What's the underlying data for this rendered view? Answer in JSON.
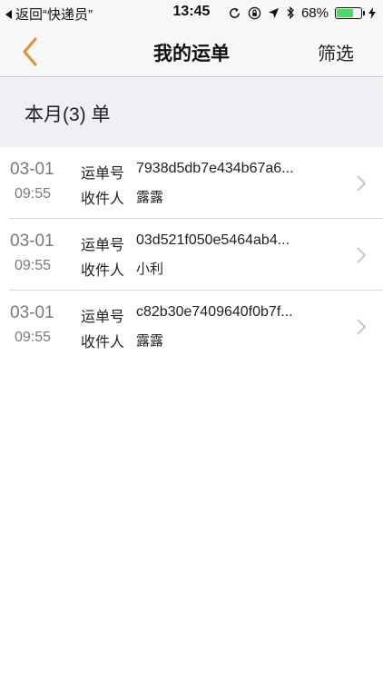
{
  "status_bar": {
    "back_label": "返回“快递员”",
    "time": "13:45",
    "battery_percent": "68%",
    "battery_level": 0.68,
    "icons": [
      "rotation-lock-icon",
      "lock-icon",
      "location-arrow-icon",
      "bluetooth-icon",
      "battery-icon",
      "charging-bolt-icon"
    ]
  },
  "nav": {
    "back_icon": "chevron-left-icon",
    "title": "我的运单",
    "filter_label": "筛选",
    "accent_color": "#e8902a"
  },
  "section": {
    "header": "本月(3) 单"
  },
  "orders": [
    {
      "date": "03-01",
      "time": "09:55",
      "waybill_label": "运单号",
      "waybill_no": "7938d5db7e434b67a6...",
      "recipient_label": "收件人",
      "recipient": "露露"
    },
    {
      "date": "03-01",
      "time": "09:55",
      "waybill_label": "运单号",
      "waybill_no": "03d521f050e5464ab4...",
      "recipient_label": "收件人",
      "recipient": "小利"
    },
    {
      "date": "03-01",
      "time": "09:55",
      "waybill_label": "运单号",
      "waybill_no": "c82b30e7409640f0b7f...",
      "recipient_label": "收件人",
      "recipient": "露露"
    }
  ]
}
